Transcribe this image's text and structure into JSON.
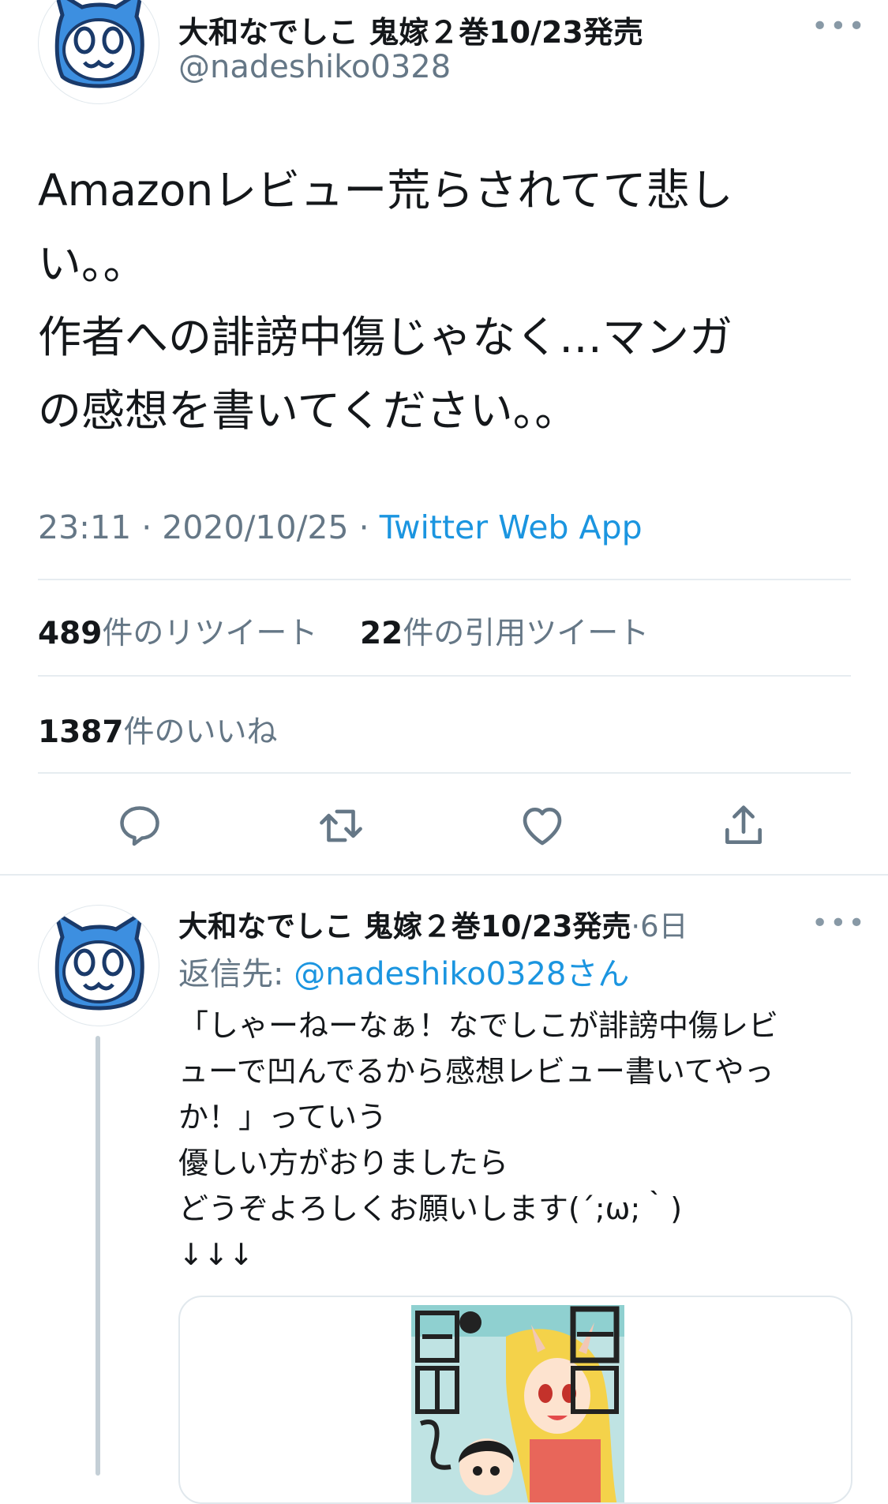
{
  "tweet": {
    "display_name": "大和なでしこ 鬼嫁２巻10/23発売",
    "handle": "@nadeshiko0328",
    "text_lines": [
      "Amazonレビュー荒らされてて悲し",
      "い。。",
      "作者への誹謗中傷じゃなく…マンガ",
      "の感想を書いてください。。"
    ],
    "time": "23:11",
    "date": "2020/10/25",
    "separator": " · ",
    "source": "Twitter Web App",
    "retweet_count": "489",
    "retweet_label": "件のリツイート",
    "quote_count": "22",
    "quote_label": "件の引用ツイート",
    "like_count": "1387",
    "like_label": "件のいいね",
    "more": "•••"
  },
  "reply": {
    "display_name": "大和なでしこ 鬼嫁２巻10/23発売",
    "age": "·6日",
    "replying_prefix": "返信先: ",
    "replying_handle": "@nadeshiko0328",
    "replying_suffix": "さん",
    "text_lines": [
      "「しゃーねーなぁ！なでしこが誹謗中傷レビ",
      "ューで凹んでるから感想レビュー書いてやっ",
      "か！」っていう",
      "優しい方がおりましたら",
      "どうぞよろしくお願いします(´;ω;｀)",
      "↓↓↓"
    ],
    "more": "•••"
  },
  "colors": {
    "accent": "#1b95e0",
    "secondary_text": "#657786",
    "divider": "#e6ecf0",
    "avatar_blue": "#3d8fe0"
  },
  "icons": [
    "cat-avatar-icon",
    "reply-icon",
    "retweet-icon",
    "like-icon",
    "share-icon",
    "more-icon"
  ]
}
